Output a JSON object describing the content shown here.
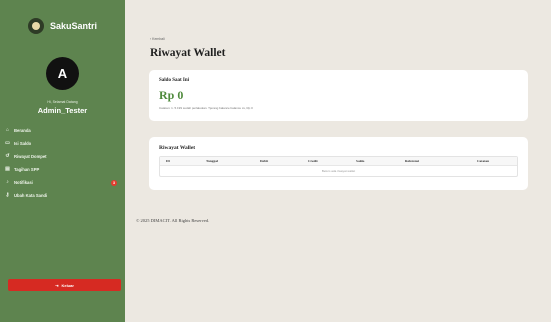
{
  "brand": {
    "name": "SakuSantri",
    "logo_icon": "mosque-logo-icon"
  },
  "user": {
    "initial": "A",
    "caption": "Hi, Selamat Datang",
    "name": "Admin_Tester"
  },
  "nav": {
    "items": [
      {
        "label": "Beranda",
        "icon": "home-icon"
      },
      {
        "label": "Isi Saldo",
        "icon": "wallet-icon"
      },
      {
        "label": "Riwayat Dompet",
        "icon": "history-icon"
      },
      {
        "label": "Tagihan SPP",
        "icon": "bill-icon"
      },
      {
        "label": "Notifikasi",
        "icon": "bell-icon",
        "badge": "3"
      },
      {
        "label": "Ubah Kata Sandi",
        "icon": "key-icon"
      }
    ]
  },
  "logout": {
    "label": "Keluar",
    "icon": "logout-icon"
  },
  "breadcrumb": "‹ Kembali",
  "page_title": "Riwayat Wallet",
  "balance": {
    "label": "Saldo Saat Ini",
    "value": "Rp 0",
    "note": "Catatan: 1. 5.199 sudah perlakukan. Tjerang balance balance cs, Rp 0"
  },
  "history": {
    "title": "Riwayat Wallet",
    "columns": [
      "ID",
      "Tanggal",
      "Debit",
      "Credit",
      "Saldo",
      "Referensi",
      "Catatan"
    ],
    "empty_text": "Belum ada riwayat wallet"
  },
  "footer": "© 2025 DIMACIT. All Rights Reserved.",
  "colors": {
    "sidebar": "#5e844f",
    "accent": "#4f8a3c",
    "danger": "#d62a22",
    "background": "#ece8e1"
  }
}
